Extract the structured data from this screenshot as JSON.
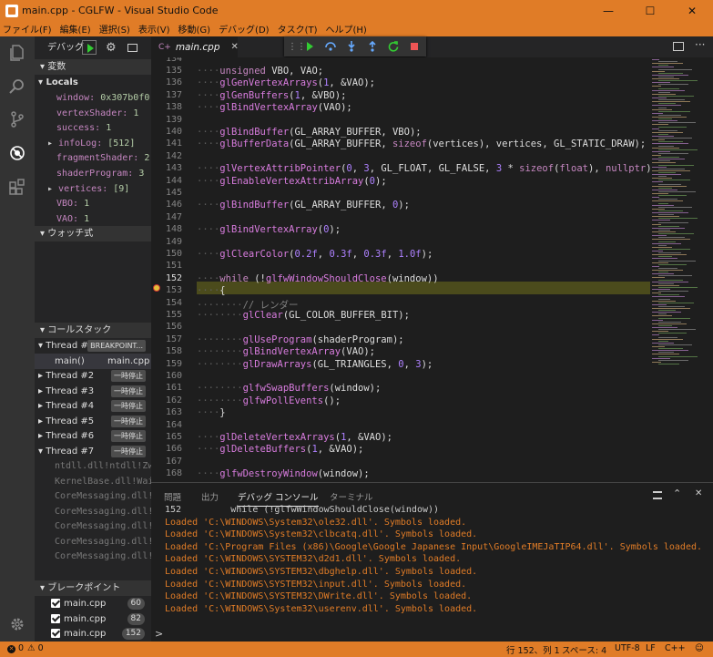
{
  "window": {
    "title": "main.cpp - CGLFW - Visual Studio Code",
    "minimize": "—",
    "maximize": "☐",
    "close": "✕"
  },
  "menu": [
    "ファイル(F)",
    "編集(E)",
    "選択(S)",
    "表示(V)",
    "移動(G)",
    "デバッグ(D)",
    "タスク(T)",
    "ヘルプ(H)"
  ],
  "sidebar": {
    "debug_label": "デバッグ",
    "variables_header": "変数",
    "locals_label": "Locals",
    "variables": [
      {
        "name": "window:",
        "value": "0x307b0f0",
        "expandable": false
      },
      {
        "name": "vertexShader:",
        "value": "1",
        "expandable": false
      },
      {
        "name": "success:",
        "value": "1",
        "expandable": false
      },
      {
        "name": "infoLog:",
        "value": "[512]",
        "expandable": true
      },
      {
        "name": "fragmentShader:",
        "value": "2",
        "expandable": false
      },
      {
        "name": "shaderProgram:",
        "value": "3",
        "expandable": false
      },
      {
        "name": "vertices:",
        "value": "[9]",
        "expandable": true
      },
      {
        "name": "VBO:",
        "value": "1",
        "expandable": false
      },
      {
        "name": "VAO:",
        "value": "1",
        "expandable": false
      }
    ],
    "watch_header": "ウォッチ式",
    "callstack_header": "コールスタック",
    "threads": [
      {
        "name": "Thread #1",
        "state": "BREAKPOINT...",
        "expanded": true
      },
      {
        "name": "Thread #2",
        "state": "一時停止"
      },
      {
        "name": "Thread #3",
        "state": "一時停止"
      },
      {
        "name": "Thread #4",
        "state": "一時停止"
      },
      {
        "name": "Thread #5",
        "state": "一時停止"
      },
      {
        "name": "Thread #6",
        "state": "一時停止"
      },
      {
        "name": "Thread #7",
        "state": "一時停止",
        "expanded": true
      }
    ],
    "main_frame": {
      "fn": "main()",
      "file": "main.cpp"
    },
    "frames": [
      "ntdll.dll!ntdll!ZwW",
      "KernelBase.dll!Wait",
      "CoreMessaging.dll!Co",
      "CoreMessaging.dll!Co",
      "CoreMessaging.dll!Co",
      "CoreMessaging.dll!Co",
      "CoreMessaging.dll!Co"
    ],
    "breakpoints_header": "ブレークポイント",
    "breakpoints": [
      {
        "file": "main.cpp",
        "line": "60"
      },
      {
        "file": "main.cpp",
        "line": "82"
      },
      {
        "file": "main.cpp",
        "line": "152"
      }
    ]
  },
  "editor": {
    "tab_label": "main.cpp",
    "tab_close": "✕",
    "current_line": 152,
    "lines": [
      {
        "n": "134",
        "t": ""
      },
      {
        "n": "135",
        "t": "····unsigned VBO, VAO;"
      },
      {
        "n": "136",
        "t": "····glGenVertexArrays(1, &VAO);"
      },
      {
        "n": "137",
        "t": "····glGenBuffers(1, &VBO);"
      },
      {
        "n": "138",
        "t": "····glBindVertexArray(VAO);"
      },
      {
        "n": "139",
        "t": ""
      },
      {
        "n": "140",
        "t": "····glBindBuffer(GL_ARRAY_BUFFER, VBO);"
      },
      {
        "n": "141",
        "t": "····glBufferData(GL_ARRAY_BUFFER, sizeof(vertices), vertices, GL_STATIC_DRAW);"
      },
      {
        "n": "142",
        "t": ""
      },
      {
        "n": "143",
        "t": "····glVertexAttribPointer(0, 3, GL_FLOAT, GL_FALSE, 3 * sizeof(float), nullptr);"
      },
      {
        "n": "144",
        "t": "····glEnableVertexAttribArray(0);"
      },
      {
        "n": "145",
        "t": ""
      },
      {
        "n": "146",
        "t": "····glBindBuffer(GL_ARRAY_BUFFER, 0);"
      },
      {
        "n": "147",
        "t": ""
      },
      {
        "n": "148",
        "t": "····glBindVertexArray(0);"
      },
      {
        "n": "149",
        "t": ""
      },
      {
        "n": "150",
        "t": "····glClearColor(0.2f, 0.3f, 0.3f, 1.0f);"
      },
      {
        "n": "151",
        "t": ""
      },
      {
        "n": "152",
        "t": "····while (!glfwWindowShouldClose(window))"
      },
      {
        "n": "153",
        "t": "····{"
      },
      {
        "n": "154",
        "t": "········// レンダー"
      },
      {
        "n": "155",
        "t": "········glClear(GL_COLOR_BUFFER_BIT);"
      },
      {
        "n": "156",
        "t": ""
      },
      {
        "n": "157",
        "t": "········glUseProgram(shaderProgram);"
      },
      {
        "n": "158",
        "t": "········glBindVertexArray(VAO);"
      },
      {
        "n": "159",
        "t": "········glDrawArrays(GL_TRIANGLES, 0, 3);"
      },
      {
        "n": "160",
        "t": ""
      },
      {
        "n": "161",
        "t": "········glfwSwapBuffers(window);"
      },
      {
        "n": "162",
        "t": "········glfwPollEvents();"
      },
      {
        "n": "163",
        "t": "····}"
      },
      {
        "n": "164",
        "t": ""
      },
      {
        "n": "165",
        "t": "····glDeleteVertexArrays(1, &VAO);"
      },
      {
        "n": "166",
        "t": "····glDeleteBuffers(1, &VAO);"
      },
      {
        "n": "167",
        "t": ""
      },
      {
        "n": "168",
        "t": "····glfwDestroyWindow(window);"
      }
    ]
  },
  "panel": {
    "tabs": [
      "問題",
      "出力",
      "デバッグ コンソール",
      "ターミナル"
    ],
    "active_tab": 2,
    "console_lines": [
      {
        "text": "152         while (!glfwWindowShouldClose(window))",
        "dim": true
      },
      {
        "text": "Loaded 'C:\\WINDOWS\\System32\\ole32.dll'. Symbols loaded."
      },
      {
        "text": "Loaded 'C:\\WINDOWS\\System32\\clbcatq.dll'. Symbols loaded."
      },
      {
        "text": "Loaded 'C:\\Program Files (x86)\\Google\\Google Japanese Input\\GoogleIMEJaTIP64.dll'. Symbols loaded."
      },
      {
        "text": "Loaded 'C:\\WINDOWS\\SYSTEM32\\d2d1.dll'. Symbols loaded."
      },
      {
        "text": "Loaded 'C:\\WINDOWS\\SYSTEM32\\dbghelp.dll'. Symbols loaded."
      },
      {
        "text": "Loaded 'C:\\WINDOWS\\SYSTEM32\\input.dll'. Symbols loaded."
      },
      {
        "text": "Loaded 'C:\\WINDOWS\\SYSTEM32\\DWrite.dll'. Symbols loaded."
      },
      {
        "text": "Loaded 'C:\\WINDOWS\\System32\\userenv.dll'. Symbols loaded."
      }
    ],
    "prompt": ">"
  },
  "status": {
    "errors": "0",
    "warnings": "0",
    "position": "行 152、列 1",
    "spaces": "スペース: 4",
    "encoding": "UTF-8",
    "eol": "LF",
    "language": "C++",
    "smiley": "☺"
  },
  "colors": {
    "accent": "#e07c27",
    "current_line": "#4b4b1c"
  }
}
